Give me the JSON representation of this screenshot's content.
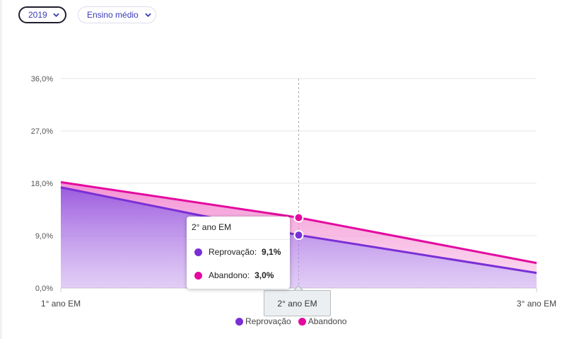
{
  "filters": {
    "year": "2019",
    "level": "Ensino médio"
  },
  "colors": {
    "reprovacao": "#7a2fd6",
    "abandono": "#e3099f",
    "grid": "#e6e6e6",
    "axis_text": "#555555"
  },
  "chart_data": {
    "type": "area",
    "title": "",
    "xlabel": "",
    "ylabel": "",
    "categories": [
      "1° ano EM",
      "2° ano EM",
      "3° ano EM"
    ],
    "y_ticks": [
      "0,0%",
      "9,0%",
      "18,0%",
      "27,0%",
      "36,0%"
    ],
    "y_tick_values": [
      0,
      9,
      18,
      27,
      36
    ],
    "ylim": [
      0,
      36
    ],
    "stacked": true,
    "grid": true,
    "legend_position": "bottom-center",
    "series": [
      {
        "name": "Reprovação",
        "values": [
          17.3,
          9.1,
          2.6
        ]
      },
      {
        "name": "Abandono",
        "values": [
          0.9,
          3.0,
          1.7
        ]
      }
    ]
  },
  "tooltip": {
    "title": "2° ano EM",
    "rows": [
      {
        "label": "Reprovação:",
        "value": "9,1%"
      },
      {
        "label": "Abandono:",
        "value": "3,0%"
      }
    ]
  },
  "x_highlight": "2° ano EM",
  "legend": {
    "items": [
      "Reprovação",
      "Abandono"
    ]
  }
}
